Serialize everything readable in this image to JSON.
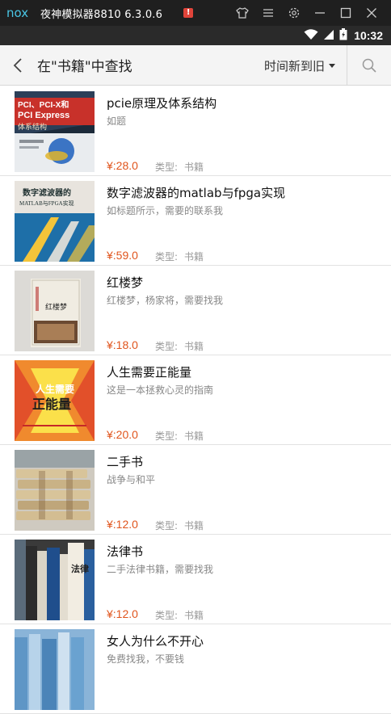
{
  "emulator": {
    "title": "夜神模拟器8810 6.3.0.6",
    "alert_badge": "!",
    "logo_text": "nox"
  },
  "status_bar": {
    "time": "10:32"
  },
  "header": {
    "title": "在\"书籍\"中查找",
    "sort_label": "时间新到旧"
  },
  "listings": [
    {
      "title": "pcie原理及体系结构",
      "desc": "如题",
      "price": "¥:28.0",
      "type_label": "类型:",
      "type_value": "书籍"
    },
    {
      "title": "数字滤波器的matlab与fpga实现",
      "desc": "如标题所示，需要的联系我",
      "price": "¥:59.0",
      "type_label": "类型:",
      "type_value": "书籍"
    },
    {
      "title": "红楼梦",
      "desc": "红楼梦，杨家将，需要找我",
      "price": "¥:18.0",
      "type_label": "类型:",
      "type_value": "书籍"
    },
    {
      "title": "人生需要正能量",
      "desc": "这是一本拯救心灵的指南",
      "price": "¥:20.0",
      "type_label": "类型:",
      "type_value": "书籍"
    },
    {
      "title": "二手书",
      "desc": "战争与和平",
      "price": "¥:12.0",
      "type_label": "类型:",
      "type_value": "书籍"
    },
    {
      "title": "法律书",
      "desc": "二手法律书籍，需要找我",
      "price": "¥:12.0",
      "type_label": "类型:",
      "type_value": "书籍"
    },
    {
      "title": "女人为什么不开心",
      "desc": "免费找我，不要钱",
      "price": "",
      "type_label": "",
      "type_value": ""
    }
  ],
  "thumbs": {
    "pcie": {
      "line1": "PCI、PCI-X和",
      "line2": "PCI Express",
      "line3": "体系结构"
    },
    "filter": {
      "line1": "数字滤波器的",
      "line2": "MATLAB与FPGA实现"
    },
    "hongloumeng": {
      "line1": "红楼梦"
    },
    "zhengnengliang": {
      "line1": "人生需要",
      "line2": "正能量"
    },
    "law": {
      "line1": "法律"
    }
  }
}
